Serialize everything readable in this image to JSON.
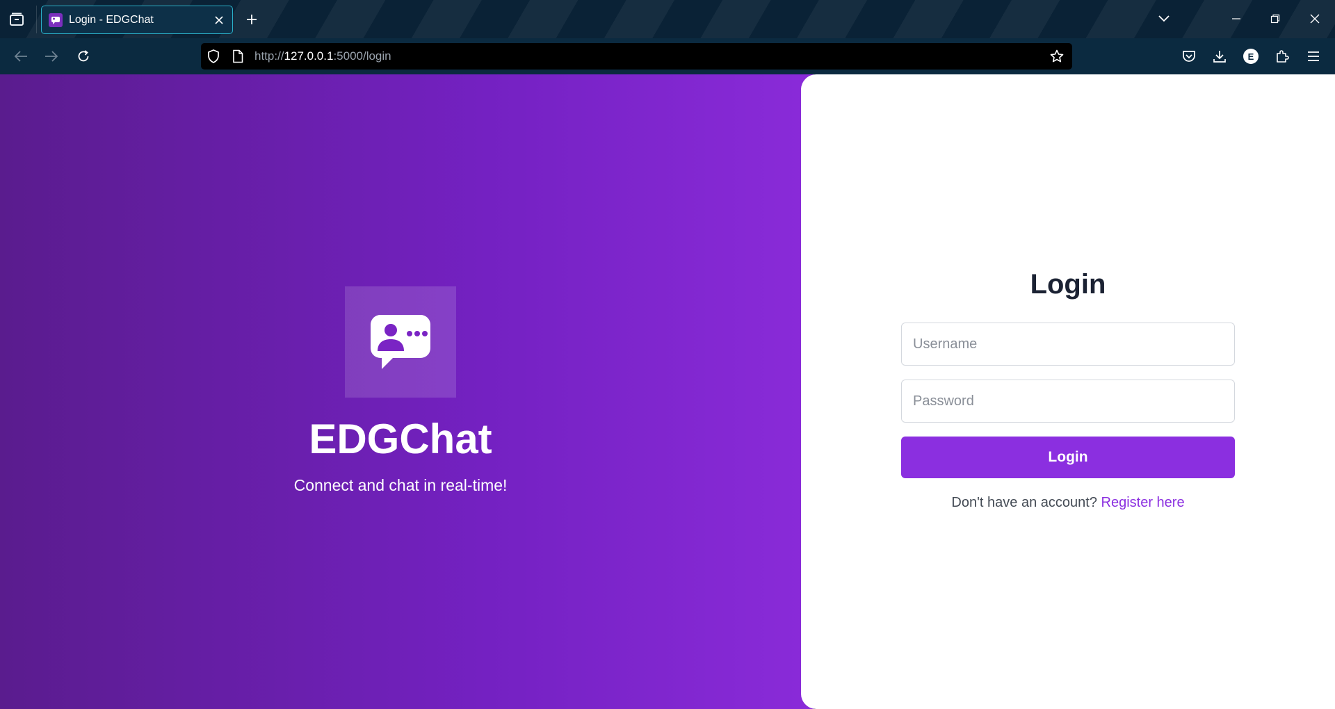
{
  "browser": {
    "tab_title": "Login - EDGChat",
    "url_scheme": "http://",
    "url_host": "127.0.0.1",
    "url_rest": ":5000/login",
    "account_initial": "E"
  },
  "hero": {
    "app_name": "EDGChat",
    "tagline": "Connect and chat in real-time!",
    "logo_icon": "chat-user-bubble-icon"
  },
  "login": {
    "title": "Login",
    "username_placeholder": "Username",
    "password_placeholder": "Password",
    "button_label": "Login",
    "register_prompt": "Don't have an account?",
    "register_link": "Register here"
  },
  "colors": {
    "accent": "#8b2fe0",
    "hero_gradient_start": "#5a1c8e",
    "hero_gradient_end": "#8a2bd9",
    "chrome_bg": "#0b2a40"
  }
}
